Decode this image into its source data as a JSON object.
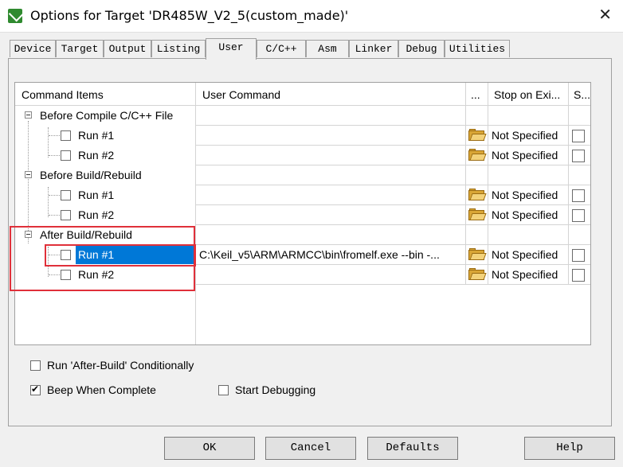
{
  "window": {
    "title": "Options for Target 'DR485W_V2_5(custom_made)'",
    "close_glyph": "✕"
  },
  "tabs": [
    {
      "label": "Device"
    },
    {
      "label": "Target"
    },
    {
      "label": "Output"
    },
    {
      "label": "Listing"
    },
    {
      "label": "User",
      "active": true
    },
    {
      "label": "C/C++"
    },
    {
      "label": "Asm"
    },
    {
      "label": "Linker"
    },
    {
      "label": "Debug"
    },
    {
      "label": "Utilities"
    }
  ],
  "grid": {
    "headers": [
      "Command Items",
      "User Command",
      "...",
      "Stop on Exi...",
      "S..."
    ],
    "rows": [
      {
        "type": "group",
        "label": "Before Compile C/C++ File"
      },
      {
        "type": "item",
        "label": "Run #1",
        "command": "",
        "stop": "Not Specified"
      },
      {
        "type": "item",
        "label": "Run #2",
        "command": "",
        "stop": "Not Specified"
      },
      {
        "type": "group",
        "label": "Before Build/Rebuild"
      },
      {
        "type": "item",
        "label": "Run #1",
        "command": "",
        "stop": "Not Specified"
      },
      {
        "type": "item",
        "label": "Run #2",
        "command": "",
        "stop": "Not Specified"
      },
      {
        "type": "group",
        "label": "After Build/Rebuild"
      },
      {
        "type": "item",
        "label": "Run #1",
        "command": "C:\\Keil_v5\\ARM\\ARMCC\\bin\\fromelf.exe --bin -...",
        "stop": "Not Specified",
        "selected": true
      },
      {
        "type": "item",
        "label": "Run #2",
        "command": "",
        "stop": "Not Specified"
      }
    ]
  },
  "options": {
    "run_after_build": {
      "label": "Run 'After-Build' Conditionally",
      "checked": false
    },
    "beep_when_complete": {
      "label": "Beep When Complete",
      "checked": true
    },
    "start_debugging": {
      "label": "Start Debugging",
      "checked": false
    }
  },
  "buttons": {
    "ok": "OK",
    "cancel": "Cancel",
    "defaults": "Defaults",
    "help": "Help"
  }
}
